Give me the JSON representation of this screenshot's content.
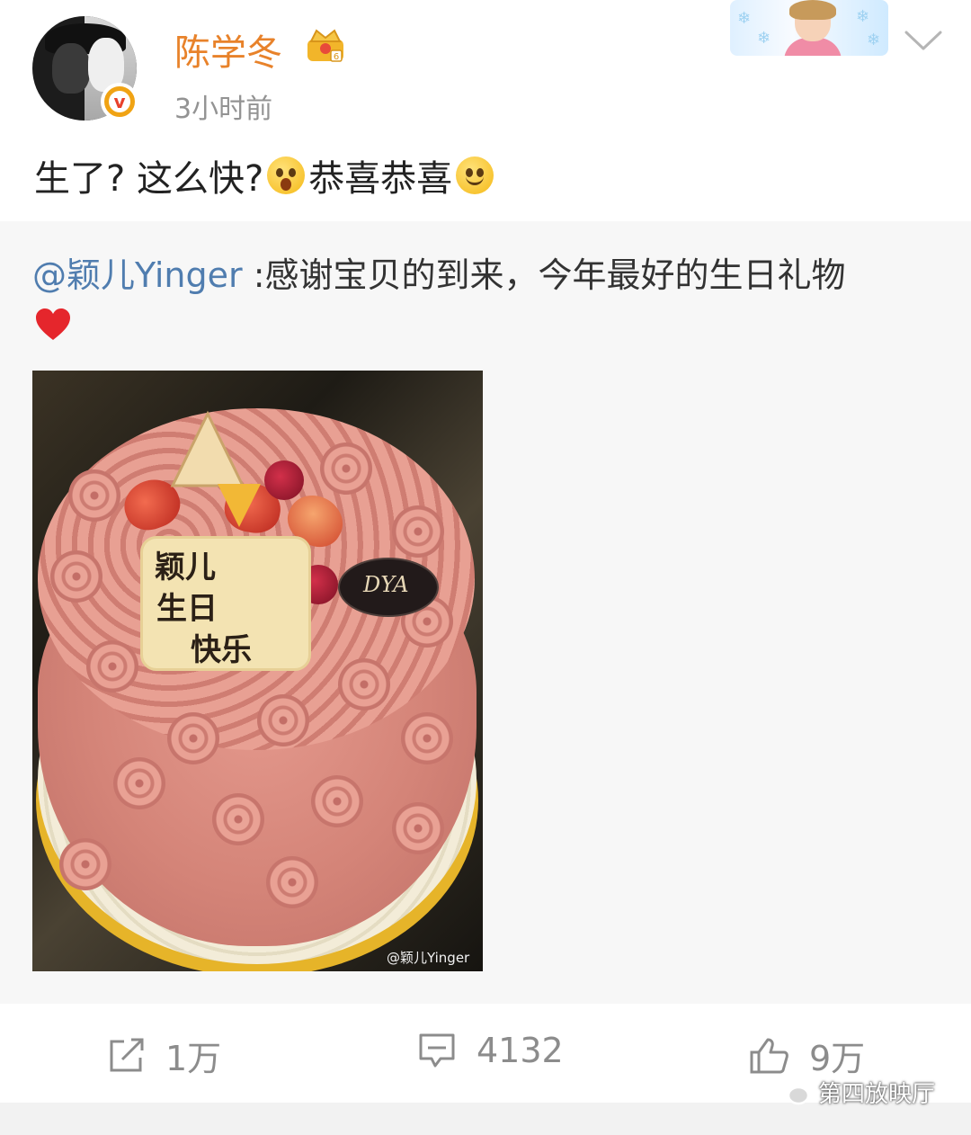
{
  "post": {
    "username": "陈学冬",
    "timestamp": "3小时前",
    "text_before": "生了? 这么快?",
    "text_after": "恭喜恭喜",
    "badge_letter": "v"
  },
  "repost": {
    "mention": "@颖儿Yinger",
    "text": " :感谢宝贝的到来，今年最好的生日礼物",
    "image": {
      "plaque_line1": "颖儿",
      "plaque_line2": "生日",
      "plaque_line3": "快乐",
      "logo_text": "DYA",
      "watermark": "@颖儿Yinger"
    }
  },
  "actions": {
    "repost_count": "1万",
    "comment_count": "4132",
    "like_count": "9万"
  },
  "footer": {
    "wechat_account": "第四放映厅"
  },
  "colors": {
    "username": "#e8822a",
    "mention": "#507daf",
    "muted": "#8c8c8c",
    "verified_badge": "#f0a314"
  },
  "icons": [
    "avatar",
    "verified-badge-icon",
    "crown-icon",
    "chevron-down-icon",
    "surprised-emoji-icon",
    "smile-emoji-icon",
    "heart-icon",
    "repost-icon",
    "comment-icon",
    "like-icon",
    "wechat-icon"
  ]
}
